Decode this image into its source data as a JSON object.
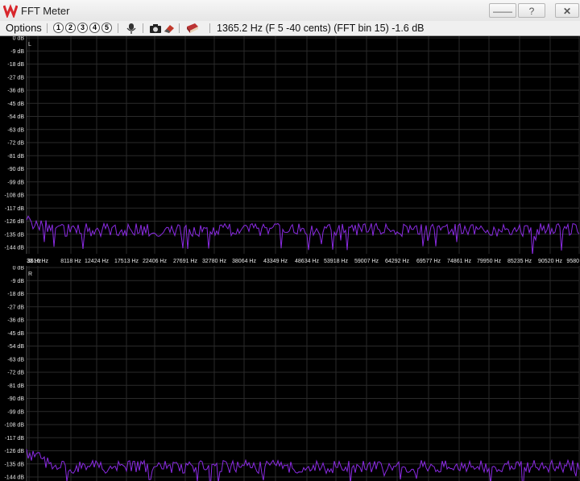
{
  "window": {
    "title": "FFT Meter",
    "minimize_label": "——",
    "help_label": "?",
    "close_label": "✕",
    "app_icon": "waveform-logo-icon"
  },
  "toolbar": {
    "options_label": "Options",
    "presets": [
      "1",
      "2",
      "3",
      "4",
      "5"
    ],
    "icons": [
      "mic-icon",
      "camera-icon",
      "eraser-icon",
      "book-icon"
    ],
    "status": "1365.2 Hz (F 5 -40 cents) (FFT bin 15) -1.6 dB"
  },
  "chart_data": {
    "type": "line",
    "db_ticks": [
      "0 dB",
      "-9 dB",
      "-18 dB",
      "-27 dB",
      "-36 dB",
      "-45 dB",
      "-54 dB",
      "-63 dB",
      "-72 dB",
      "-81 dB",
      "-90 dB",
      "-99 dB",
      "-108 dB",
      "-117 dB",
      "-126 dB",
      "-135 dB",
      "-144 dB"
    ],
    "freq_ticks": [
      "33 Hz",
      "3616 Hz",
      "8118 Hz",
      "12424 Hz",
      "17513 Hz",
      "22406 Hz",
      "27691 Hz",
      "32780 Hz",
      "38064 Hz",
      "43349 Hz",
      "48634 Hz",
      "53918 Hz",
      "59007 Hz",
      "64292 Hz",
      "69577 Hz",
      "74861 Hz",
      "79950 Hz",
      "85235 Hz",
      "90520 Hz",
      "9580"
    ],
    "ylim": [
      -144,
      0
    ],
    "channels": [
      {
        "name": "L",
        "start_level": -126,
        "noise_level": -132,
        "color": "#8a2be2"
      },
      {
        "name": "R",
        "start_level": -128,
        "noise_level": -137,
        "color": "#8a2be2"
      }
    ],
    "grid": true,
    "grid_color": "#2a2a2a",
    "background": "#000000"
  }
}
